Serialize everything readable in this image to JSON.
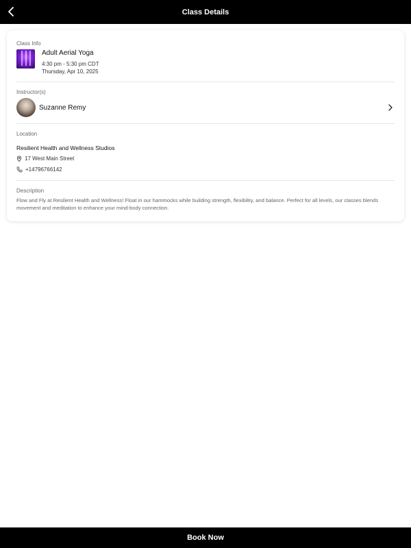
{
  "header": {
    "title": "Class Details",
    "back_icon": "chevron-left-icon"
  },
  "class_info": {
    "label": "Class Info",
    "name": "Adult Aerial Yoga",
    "time": "4:30 pm - 5:30 pm CDT",
    "date": "Thursday, Apr 10, 2025"
  },
  "instructors": {
    "label": "Instructor(s)",
    "name": "Suzanne Remy"
  },
  "location": {
    "label": "Location",
    "studio": "Resilient Health and Wellness Studios",
    "address": "17 West Main Street",
    "phone": "+14796766142"
  },
  "description": {
    "label": "Description",
    "text": "Flow and Fly at Resilient Health and Wellness! Float in our hammocks while building strength, flexibility, and balance. Perfect for all levels, our classes blends movement and meditation to enhance your mind-body connection."
  },
  "footer": {
    "cta_label": "Book Now"
  },
  "colors": {
    "bar_background": "#000000",
    "card_background": "#ffffff",
    "muted_text": "#666666"
  }
}
